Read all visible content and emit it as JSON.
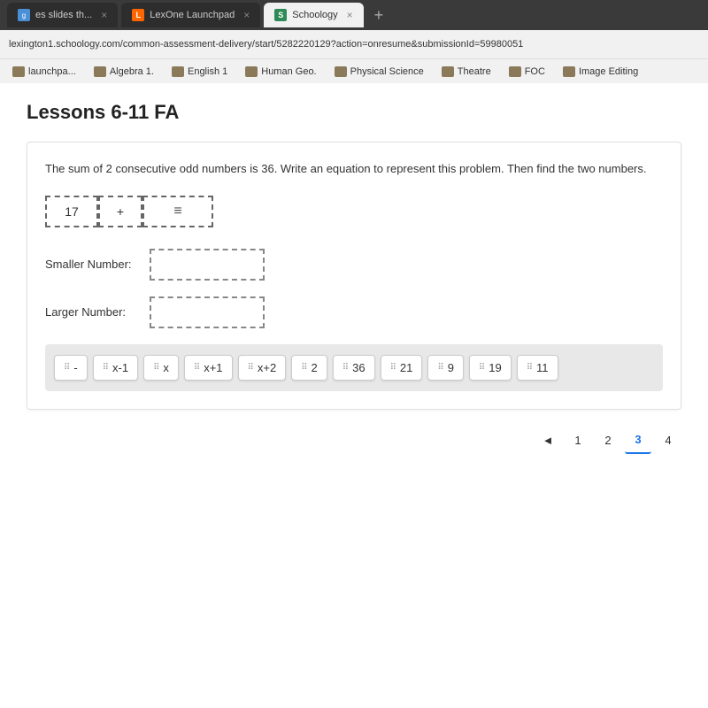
{
  "browser": {
    "tabs": [
      {
        "id": "slides",
        "label": "es slides th...",
        "favicon": "generic",
        "active": false,
        "close": "×"
      },
      {
        "id": "lexone",
        "label": "LexOne Launchpad",
        "favicon": "lexone",
        "active": false,
        "close": "×"
      },
      {
        "id": "schoology",
        "label": "Schoology",
        "favicon": "schoology",
        "active": true,
        "close": "×"
      }
    ],
    "tab_plus": "+",
    "address": "lexington1.schoology.com/common-assessment-delivery/start/5282220129?action=onresume&submissionId=59980051",
    "bookmarks": [
      {
        "id": "launchpa",
        "label": "launchpa..."
      },
      {
        "id": "algebra1",
        "label": "Algebra 1."
      },
      {
        "id": "english1",
        "label": "English 1"
      },
      {
        "id": "humangeo",
        "label": "Human Geo."
      },
      {
        "id": "physicalscience",
        "label": "Physical Science"
      },
      {
        "id": "theatre",
        "label": "Theatre"
      },
      {
        "id": "foc",
        "label": "FOC"
      },
      {
        "id": "imageediting",
        "label": "Image Editing"
      }
    ]
  },
  "page": {
    "title": "Lessons 6-11 FA",
    "question": {
      "text": "The sum of 2 consecutive odd numbers is 36.  Write an equation to represent this problem.  Then find the two numbers.",
      "equation": {
        "box1_value": "17",
        "box2_value": "+",
        "box3_value": ""
      },
      "smaller_label": "Smaller Number:",
      "larger_label": "Larger Number:",
      "smaller_value": "",
      "larger_value": ""
    },
    "tiles": [
      {
        "id": "minus",
        "label": "-"
      },
      {
        "id": "x-1",
        "label": "x-1"
      },
      {
        "id": "x",
        "label": "x"
      },
      {
        "id": "x+1",
        "label": "x+1"
      },
      {
        "id": "x+2",
        "label": "x+2"
      },
      {
        "id": "2",
        "label": "2"
      },
      {
        "id": "36",
        "label": "36"
      },
      {
        "id": "21",
        "label": "21"
      },
      {
        "id": "9",
        "label": "9"
      },
      {
        "id": "19",
        "label": "19"
      },
      {
        "id": "11",
        "label": "11"
      }
    ],
    "pagination": {
      "prev": "◄",
      "pages": [
        "1",
        "2",
        "3",
        "4"
      ],
      "active_page": "3"
    }
  }
}
